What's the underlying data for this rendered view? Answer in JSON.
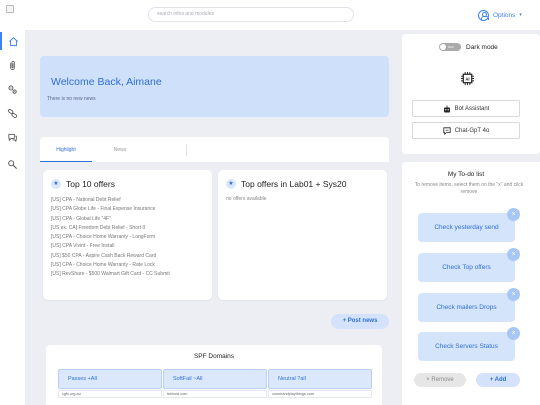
{
  "topbar": {
    "search_placeholder": "search infos and modules",
    "options_label": "Options",
    "options_caret": "▾"
  },
  "sidebar": {
    "items": [
      {
        "name": "home",
        "icon": "home-icon",
        "active": true
      },
      {
        "name": "files",
        "icon": "paperclip-icon",
        "active": false
      },
      {
        "name": "settings",
        "icon": "gears-icon",
        "active": false
      },
      {
        "name": "links",
        "icon": "link-icon",
        "active": false
      },
      {
        "name": "chat",
        "icon": "chat-icon",
        "active": false
      },
      {
        "name": "search",
        "icon": "search-key-icon",
        "active": false
      }
    ]
  },
  "welcome": {
    "title": "Welcome Back, Aimane",
    "subtitle": "There is no new news"
  },
  "tabs": {
    "highlight": "Highlight",
    "news": "News"
  },
  "offers": {
    "title": "Top 10 offers",
    "items": [
      "[US] CPA - National Debt Relief",
      "[US] CPA Globe Life - Final Expense Insurance",
      "[US] CPA - Global Life \"4F\"",
      "[US ex. CA] Freedom Debt Relief - Short II",
      "[US] CPA - Choice Home Warranty - LongForm",
      "[US] CPA Vivint - Free Install",
      "[US] $50 CPA - Aspire Cash Back Reward Card",
      "[US] CPA - Choice Home Warranty - Rate Lock",
      "[US] RevShare - $500 Walmart Gift Card - CC Submit"
    ]
  },
  "lab_offers": {
    "title": "Top offers in Lab01 + Sys20",
    "empty": "no offers available"
  },
  "post_news": "+ Post news",
  "spf": {
    "title": "SPF Domains",
    "columns": [
      "Passes +All",
      "SoftFail ~All",
      "Neutral ?all"
    ],
    "row": [
      "cgfc.org.au",
      "tekhost.com",
      "commandplaythings.com"
    ]
  },
  "right_panel": {
    "dark_mode_label": "Dark mode",
    "toggle_text": "OFF",
    "chip_icon": "ai-chip-icon",
    "bot_assistant": "Bot Assistant",
    "chatgpt": "Chat-GpT 4o"
  },
  "todo": {
    "title": "My To-do list",
    "subtitle": "To remove items, select them on the \"x\" and click remove",
    "tasks": [
      "Check yesterday send",
      "Check Top offers",
      "Check mailers Drops",
      "Check Servers Status"
    ],
    "remove_label": "Remove",
    "remove_icon": "×",
    "add_label": "+ Add"
  },
  "colors": {
    "accent": "#3b82f6",
    "background": "#eceef4",
    "welcome_bg": "#cfe0fb"
  }
}
